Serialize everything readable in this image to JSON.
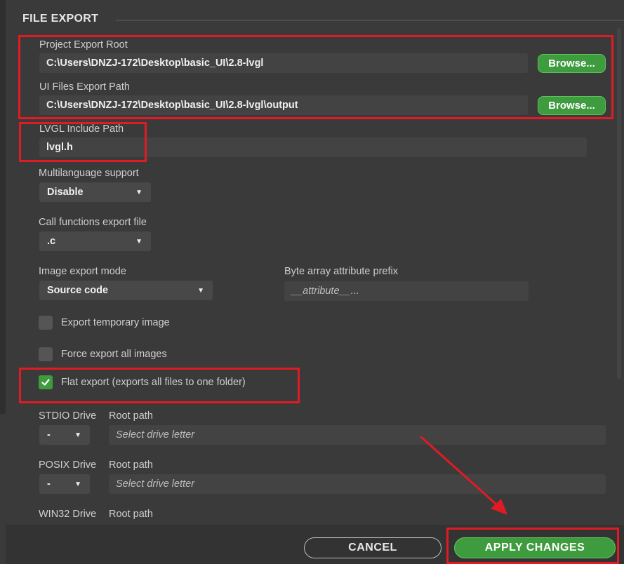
{
  "section": {
    "title": "FILE EXPORT"
  },
  "project_export_root": {
    "label": "Project Export Root",
    "value": "C:\\Users\\DNZJ-172\\Desktop\\basic_UI\\2.8-lvgl",
    "browse_label": "Browse..."
  },
  "ui_files_export_path": {
    "label": "UI Files Export Path",
    "value": "C:\\Users\\DNZJ-172\\Desktop\\basic_UI\\2.8-lvgl\\output",
    "browse_label": "Browse..."
  },
  "lvgl_include_path": {
    "label": "LVGL Include Path",
    "value": "lvgl.h"
  },
  "multilanguage_support": {
    "label": "Multilanguage support",
    "selected": "Disable"
  },
  "call_functions_export_file": {
    "label": "Call functions export file",
    "selected": ".c"
  },
  "image_export_mode": {
    "label": "Image export mode",
    "selected": "Source code"
  },
  "byte_array_attribute_prefix": {
    "label": "Byte array attribute prefix",
    "placeholder": "__attribute__..."
  },
  "export_temporary_image": {
    "label": "Export temporary image",
    "checked": false
  },
  "force_export_all_images": {
    "label": "Force export all images",
    "checked": false
  },
  "flat_export": {
    "label": "Flat export (exports all files to one folder)",
    "checked": true
  },
  "stdio_drive": {
    "label": "STDIO Drive",
    "selected": "-",
    "root_label": "Root path",
    "root_placeholder": "Select drive letter"
  },
  "posix_drive": {
    "label": "POSIX Drive",
    "selected": "-",
    "root_label": "Root path",
    "root_placeholder": "Select drive letter"
  },
  "win32_drive": {
    "label": "WIN32 Drive",
    "root_label": "Root path"
  },
  "footer": {
    "cancel_label": "CANCEL",
    "apply_label": "APPLY CHANGES"
  },
  "colors": {
    "accent_green": "#3e9b3e",
    "annotation_red": "#e01b24",
    "background": "#3a3a3a"
  }
}
